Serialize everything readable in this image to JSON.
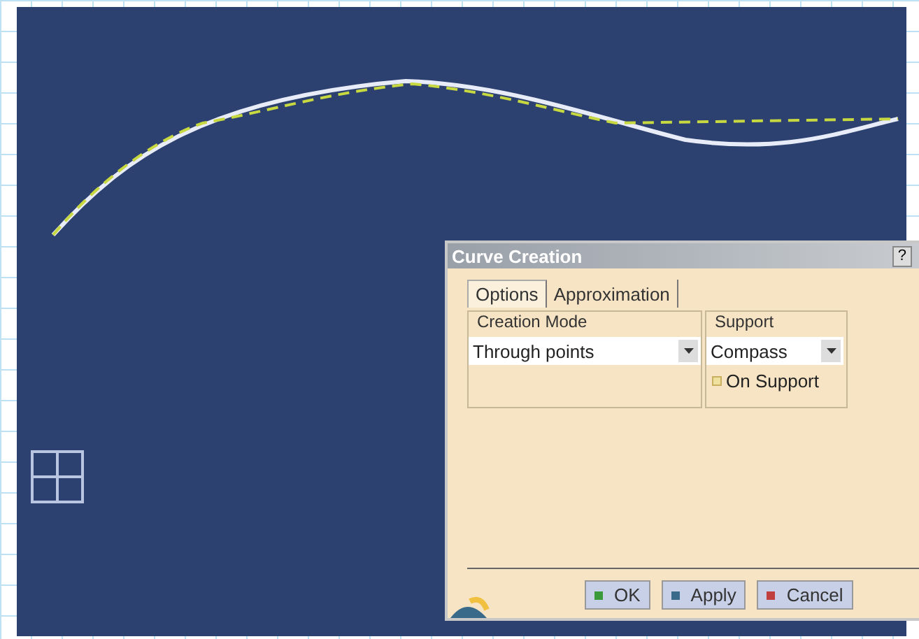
{
  "dialog": {
    "title": "Curve Creation",
    "help": "?",
    "tabs": [
      {
        "label": "Options",
        "selected": true
      },
      {
        "label": "Approximation",
        "selected": false
      }
    ],
    "creation_mode": {
      "label": "Creation Mode",
      "value": "Through points"
    },
    "support": {
      "label": "Support",
      "value": "Compass",
      "on_support": {
        "label": "On Support",
        "checked": false
      }
    },
    "buttons": [
      "OK",
      "Apply",
      "Cancel"
    ]
  }
}
